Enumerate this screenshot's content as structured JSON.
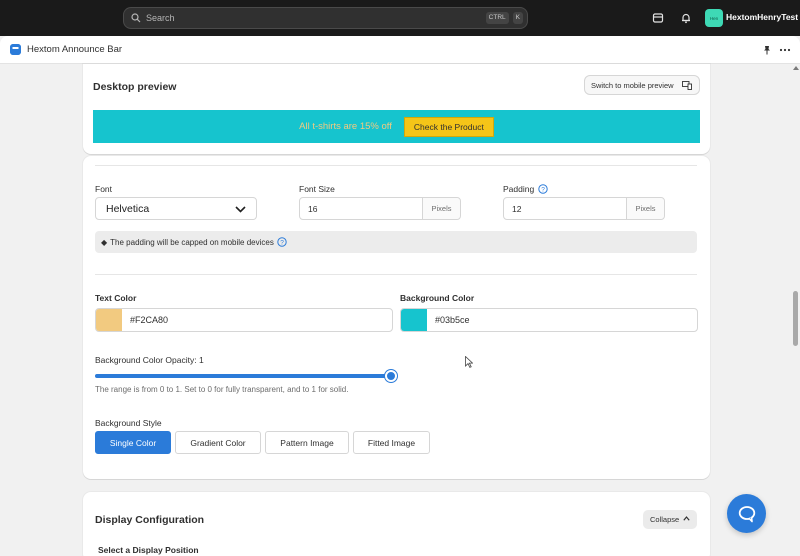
{
  "topbar": {
    "search_placeholder": "Search",
    "shortcut_key1": "CTRL",
    "shortcut_key2": "K",
    "store_badge": "Hen",
    "store_name": "HextomHenryTest",
    "icons": [
      "search-icon",
      "store-icon",
      "bell-icon"
    ]
  },
  "app_header": {
    "title": "Hextom Announce Bar",
    "icons": [
      "app-logo-icon",
      "pin-icon",
      "more-icon"
    ]
  },
  "preview": {
    "title": "Desktop preview",
    "switch_button": "Switch to mobile preview",
    "bar_text": "All t-shirts are 15% off",
    "bar_button": "Check the Product",
    "bar_background": "#16c4ce",
    "bar_text_color": "#F2CA80",
    "bar_button_color": "#f5c518"
  },
  "settings": {
    "font": {
      "label": "Font",
      "value": "Helvetica"
    },
    "font_size": {
      "label": "Font Size",
      "value": "16",
      "unit": "Pixels"
    },
    "padding": {
      "label": "Padding",
      "value": "12",
      "unit": "Pixels"
    },
    "notice": "The padding will be capped on mobile devices",
    "text_color": {
      "label": "Text Color",
      "value": "#F2CA80",
      "swatch": "#F2CA80"
    },
    "background_color": {
      "label": "Background Color",
      "value": "#03b5ce",
      "swatch": "#16c4ce"
    },
    "opacity": {
      "label": "Background Color Opacity: 1",
      "value": 1,
      "hint": "The range is from 0 to 1. Set to 0 for fully transparent, and to 1 for solid."
    },
    "background_style": {
      "label": "Background Style",
      "options": [
        "Single Color",
        "Gradient Color",
        "Pattern Image",
        "Fitted Image"
      ],
      "selected": "Single Color"
    }
  },
  "display": {
    "title": "Display Configuration",
    "collapse_button": "Collapse",
    "subtitle": "Select a Display Position"
  },
  "colors": {
    "accent": "#2b7bd9",
    "topbar": "#1a1a1a"
  }
}
